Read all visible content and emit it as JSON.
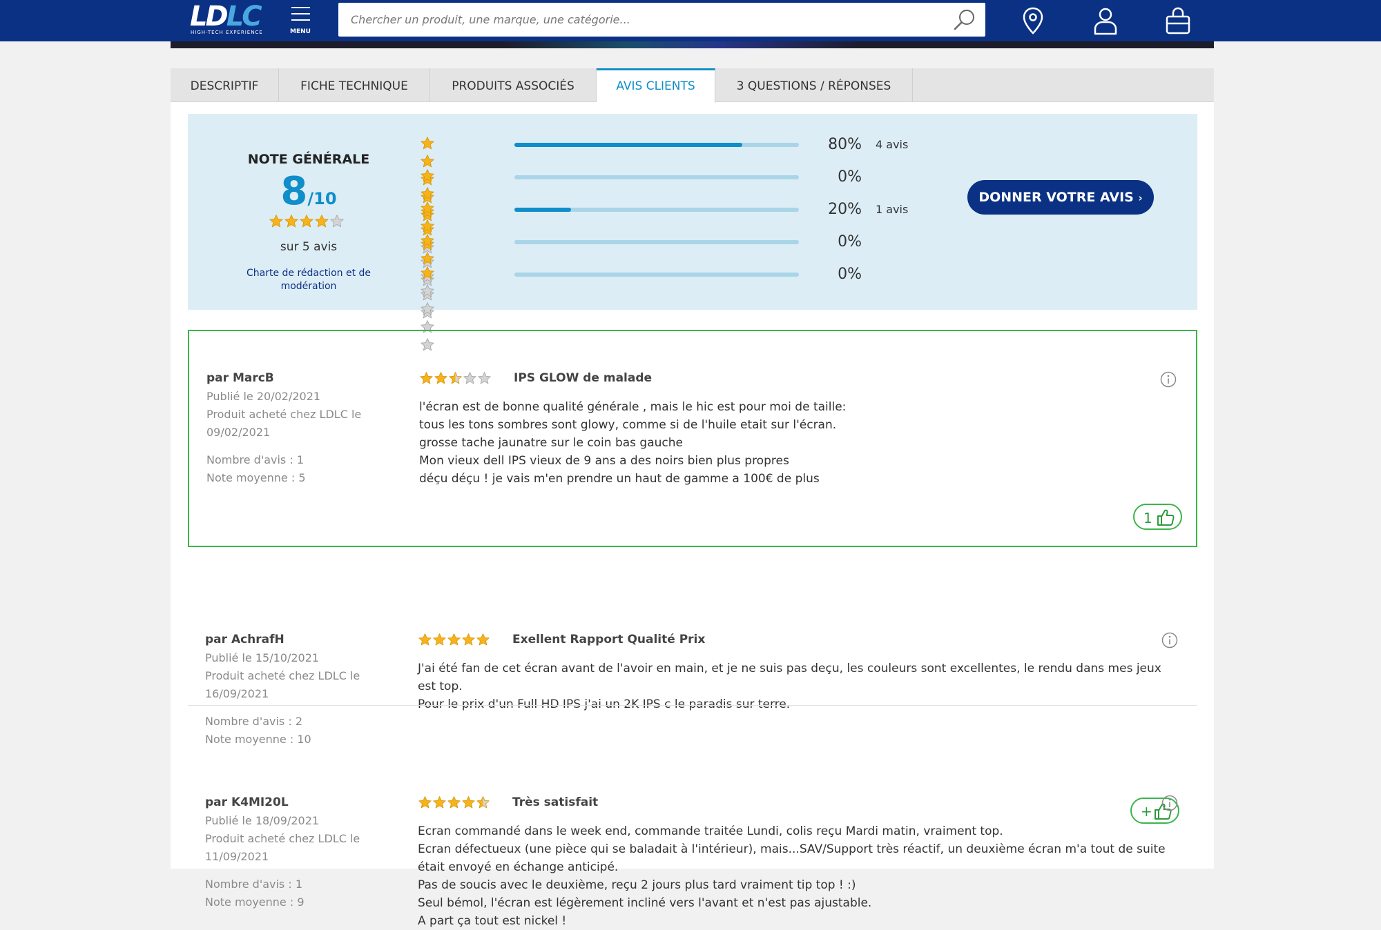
{
  "header": {
    "logo_text_a": "LD",
    "logo_text_b": "LC",
    "logo_tagline": "HIGH-TECH EXPERIENCE",
    "menu_label": "MENU",
    "search_placeholder": "Chercher un produit, une marque, une catégorie...",
    "icons": [
      "location-pin-icon",
      "user-icon",
      "cart-bag-icon"
    ],
    "colors": {
      "header_bg": "#0a3184",
      "accent": "#0f8ec9",
      "highlight_border": "#3bb54a"
    }
  },
  "tabs": [
    {
      "label": "DESCRIPTIF",
      "active": false
    },
    {
      "label": "FICHE TECHNIQUE",
      "active": false
    },
    {
      "label": "PRODUITS ASSOCIÉS",
      "active": false
    },
    {
      "label": "AVIS CLIENTS",
      "active": true
    },
    {
      "label": "3 QUESTIONS / RÉPONSES",
      "active": false
    }
  ],
  "summary": {
    "title": "NOTE GÉNÉRALE",
    "score": "8",
    "score_max": "/10",
    "stars": 4,
    "count_text": "sur 5 avis",
    "charte_link": "Charte de rédaction et de modération",
    "button_label": "DONNER VOTRE AVIS",
    "button_arrow": "›",
    "distribution": [
      {
        "stars": 5,
        "percent_value": 80,
        "percent": "80%",
        "count": "4 avis"
      },
      {
        "stars": 4,
        "percent_value": 0,
        "percent": "0%",
        "count": ""
      },
      {
        "stars": 3,
        "percent_value": 20,
        "percent": "20%",
        "count": "1 avis"
      },
      {
        "stars": 2,
        "percent_value": 0,
        "percent": "0%",
        "count": ""
      },
      {
        "stars": 1,
        "percent_value": 0,
        "percent": "0%",
        "count": ""
      }
    ]
  },
  "reviews": [
    {
      "author": "par MarcB",
      "published": "Publié le 20/02/2021",
      "bought": "Produit acheté chez LDLC le 09/02/2021",
      "nb_avis": "Nombre d'avis : 1",
      "note_moyenne": "Note moyenne : 5",
      "rating": 2.5,
      "title": "IPS GLOW de malade",
      "body": [
        "l'écran est de bonne qualité générale , mais le hic est pour moi de taille:",
        "tous les tons sombres sont glowy, comme si de l'huile etait sur l'écran.",
        "grosse tache jaunatre sur le coin bas gauche",
        "Mon vieux dell IPS vieux de 9 ans a des noirs bien plus propres",
        "déçu déçu ! je vais m'en prendre un haut de gamme a 100€ de plus"
      ],
      "likes": "1"
    },
    {
      "author": "par AchrafH",
      "published": "Publié le 15/10/2021",
      "bought": "Produit acheté chez LDLC le 16/09/2021",
      "nb_avis": "Nombre d'avis : 2",
      "note_moyenne": "Note moyenne : 10",
      "rating": 5,
      "title": "Exellent Rapport Qualité Prix",
      "body": [
        "J'ai été fan de cet écran avant de l'avoir en main, et je ne suis pas deçu, les couleurs sont excellentes, le rendu dans mes jeux est top.",
        "Pour le prix d'un Full HD IPS j'ai un 2K IPS c le paradis sur terre."
      ],
      "likes": "+"
    },
    {
      "author": "par K4MI20L",
      "published": "Publié le 18/09/2021",
      "bought": "Produit acheté chez LDLC le 11/09/2021",
      "nb_avis": "Nombre d'avis : 1",
      "note_moyenne": "Note moyenne : 9",
      "rating": 4.5,
      "title": "Très satisfait",
      "body": [
        "Ecran commandé dans le week end, commande traitée Lundi, colis reçu Mardi matin, vraiment top.",
        "Ecran défectueux (une pièce qui se baladait à l'intérieur), mais...SAV/Support très réactif, un deuxième écran m'a tout de suite était envoyé en échange anticipé.",
        "Pas de soucis avec le deuxième, reçu 2 jours plus tard vraiment tip top ! :)",
        "Seul bémol, l'écran est légèrement incliné vers l'avant et n'est pas ajustable.",
        "A part ça tout est nickel !"
      ],
      "likes": ""
    }
  ]
}
